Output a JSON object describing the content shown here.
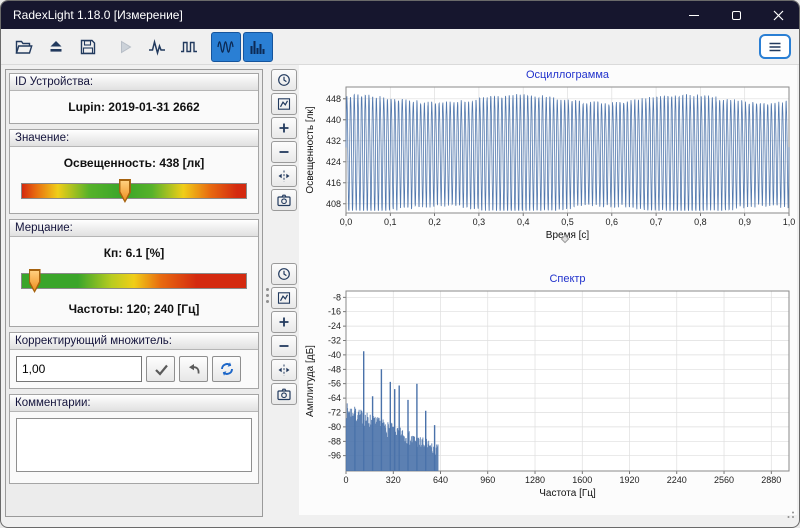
{
  "window": {
    "title": "RadexLight 1.18.0 [Измерение]",
    "control_icons": [
      "minimize-icon",
      "maximize-icon",
      "close-icon"
    ]
  },
  "toolbar": {
    "buttons": [
      {
        "id": "open",
        "icon": "folder-open-icon",
        "state": "normal"
      },
      {
        "id": "eject",
        "icon": "eject-icon",
        "state": "normal"
      },
      {
        "id": "save",
        "icon": "save-icon",
        "state": "normal"
      },
      {
        "id": "play",
        "icon": "play-icon",
        "state": "disabled"
      },
      {
        "id": "pulse-measure",
        "icon": "pulse-icon",
        "state": "normal"
      },
      {
        "id": "square-wave-measure",
        "icon": "square-wave-icon",
        "state": "normal"
      },
      {
        "id": "show-oscillogram",
        "icon": "oscillogram-icon",
        "state": "selected"
      },
      {
        "id": "show-spectrum",
        "icon": "spectrum-icon",
        "state": "selected"
      }
    ],
    "menu_icon": "hamburger-menu-icon"
  },
  "left_panel": {
    "device": {
      "header": "ID Устройства:",
      "value": "Lupin: 2019-01-31 2662"
    },
    "value": {
      "header": "Значение:",
      "reading": "Освещенность: 438 [лк]",
      "gauge_position": 0.46
    },
    "flicker": {
      "header": "Мерцание:",
      "kp": "Кп: 6.1 [%]",
      "frequencies": "Частоты: 120; 240 [Гц]",
      "gauge_position": 0.06
    },
    "multiplier": {
      "header": "Корректирующий множитель:",
      "value": "1,00",
      "apply_icon": "check-icon",
      "undo_icon": "undo-icon",
      "refresh_icon": "refresh-icon"
    },
    "comments": {
      "header": "Комментарии:",
      "value": ""
    }
  },
  "chart_tools": [
    "autoscale",
    "fit-to-data",
    "zoom-in",
    "zoom-out",
    "cursor",
    "snapshot"
  ],
  "chart_data": [
    {
      "type": "line",
      "title": "Осциллограмма",
      "xlabel": "Время [с]",
      "ylabel": "Освещенность [лк]",
      "xlim": [
        0.0,
        1.0
      ],
      "ylim": [
        404.5,
        452.5
      ],
      "xticks": [
        0.0,
        0.1,
        0.2,
        0.3,
        0.4,
        0.5,
        0.6,
        0.7,
        0.8,
        0.9,
        1.0
      ],
      "xtick_labels": [
        "0,0",
        "0,1",
        "0,2",
        "0,3",
        "0,4",
        "0,5",
        "0,6",
        "0,7",
        "0,8",
        "0,9",
        "1,0"
      ],
      "yticks": [
        408,
        416,
        424,
        432,
        440,
        448
      ],
      "grid": true,
      "legend": "none",
      "line_color": "#4a72aa",
      "signal": {
        "kind": "flicker-waveform",
        "mean": 428,
        "peak": 450,
        "trough": 406,
        "fundamental_hz": 120,
        "harmonic2_hz": 240,
        "duration_s": 1.0
      }
    },
    {
      "type": "bar",
      "title": "Спектр",
      "xlabel": "Частота [Гц]",
      "ylabel": "Амплитуда [дБ]",
      "xlim": [
        0,
        3000
      ],
      "ylim": [
        -104.5,
        -4.5
      ],
      "xticks": [
        0,
        320,
        640,
        960,
        1280,
        1600,
        1920,
        2240,
        2560,
        2880
      ],
      "yticks": [
        -96,
        -88,
        -80,
        -72,
        -64,
        -56,
        -48,
        -40,
        -32,
        -24,
        -16,
        -8
      ],
      "grid": true,
      "legend": "none",
      "bar_color": "#4a72aa",
      "peaks_hz_db": [
        [
          60,
          -71
        ],
        [
          120,
          -38
        ],
        [
          180,
          -63
        ],
        [
          240,
          -48
        ],
        [
          300,
          -55
        ],
        [
          330,
          -59
        ],
        [
          360,
          -57
        ],
        [
          420,
          -65
        ],
        [
          480,
          -56
        ],
        [
          540,
          -71
        ],
        [
          600,
          -79
        ]
      ],
      "noise_floor": {
        "from_hz": 2,
        "to_hz": 625,
        "top_db_start": -71,
        "top_db_end": -94,
        "jitter_db": 9
      }
    }
  ]
}
